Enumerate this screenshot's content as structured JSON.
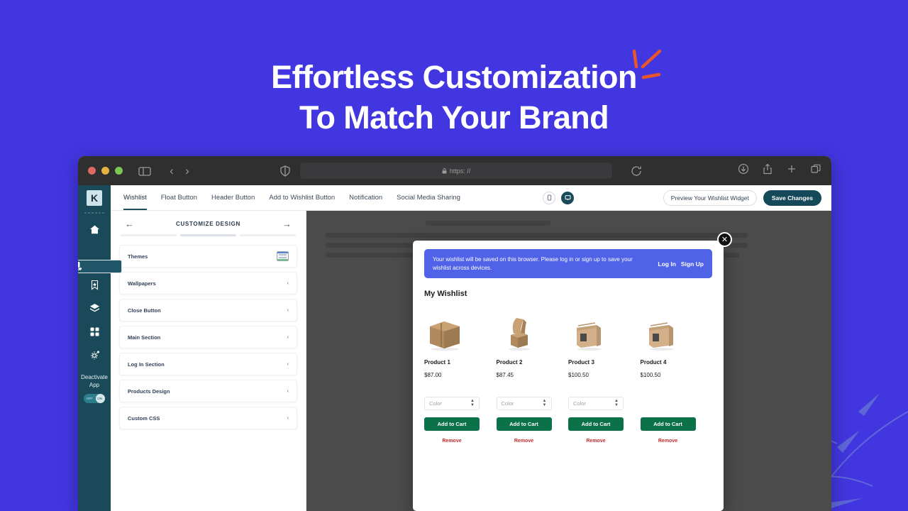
{
  "colors": {
    "background": "#4236e0",
    "accent_orange": "#e8562a",
    "brand_teal": "#1a4a59",
    "notice_blue": "#4f62e8",
    "cart_green": "#0a7148",
    "remove_red": "#c22a2a"
  },
  "hero": {
    "line1": "Effortless Customization",
    "line2": "To Match Your Brand",
    "burst_icon": "sparkle-burst-icon"
  },
  "browser": {
    "traffic_lights": [
      "close-red",
      "minimize-yellow",
      "maximize-green"
    ],
    "sidebar_icon": "sidebar-toggle-icon",
    "back_icon": "chevron-left-icon",
    "forward_icon": "chevron-right-icon",
    "shield_icon": "privacy-shield-icon",
    "url": "https: //",
    "lock_icon": "lock-icon",
    "reload_icon": "reload-icon",
    "right_icons": [
      "download-icon",
      "share-icon",
      "new-tab-icon",
      "tab-overview-icon"
    ]
  },
  "app": {
    "logo_letter": "K",
    "tabs": [
      {
        "label": "Wishlist",
        "active": true
      },
      {
        "label": "Float Button",
        "active": false
      },
      {
        "label": "Header Button",
        "active": false
      },
      {
        "label": "Add to Wishlist Button",
        "active": false
      },
      {
        "label": "Notification",
        "active": false
      },
      {
        "label": "Social Media Sharing",
        "active": false
      }
    ],
    "devices": [
      {
        "icon": "mobile-icon",
        "active": false
      },
      {
        "icon": "desktop-icon",
        "active": true
      }
    ],
    "preview_button": "Preview Your Wishlist Widget",
    "save_button": "Save Changes"
  },
  "rail": {
    "icons": [
      {
        "name": "home-icon",
        "selected": false
      },
      {
        "name": "list-heart-icon",
        "selected": true
      },
      {
        "name": "bookmark-icon",
        "selected": false
      },
      {
        "name": "layers-icon",
        "selected": false
      },
      {
        "name": "grid-icon",
        "selected": false
      },
      {
        "name": "gear-icon",
        "selected": false
      }
    ],
    "deactivate_line1": "Deactivate",
    "deactivate_line2": "App",
    "toggle_off": "OFF",
    "toggle_on": "ON",
    "toggle_state": "on"
  },
  "panel": {
    "title": "CUSTOMIZE DESIGN",
    "back_arrow": "←",
    "next_arrow": "→",
    "steps": [
      false,
      true,
      false
    ],
    "items": [
      {
        "label": "Themes",
        "has_thumb": true,
        "chevron": ""
      },
      {
        "label": "Wallpapers",
        "has_thumb": false,
        "chevron": "‹"
      },
      {
        "label": "Close Button",
        "has_thumb": false,
        "chevron": "‹"
      },
      {
        "label": "Main Section",
        "has_thumb": false,
        "chevron": "‹"
      },
      {
        "label": "Log In Section",
        "has_thumb": false,
        "chevron": "‹"
      },
      {
        "label": "Products Design",
        "has_thumb": false,
        "chevron": "‹"
      },
      {
        "label": "Custom CSS",
        "has_thumb": false,
        "chevron": "‹"
      }
    ]
  },
  "modal": {
    "close_icon": "close-icon",
    "notice_text": "Your wishlist will be saved on this browser. Please log in or sign up to save your wishlist across devices.",
    "login_label": "Log In",
    "signup_label": "Sign Up",
    "title": "My Wishlist",
    "products": [
      {
        "name": "Product 1",
        "price": "$87.00",
        "color_placeholder": "Color",
        "has_color": true,
        "cart_label": "Add to Cart",
        "remove_label": "Remove"
      },
      {
        "name": "Product 2",
        "price": "$87.45",
        "color_placeholder": "Color",
        "has_color": true,
        "cart_label": "Add to Cart",
        "remove_label": "Remove"
      },
      {
        "name": "Product 3",
        "price": "$100.50",
        "color_placeholder": "Color",
        "has_color": true,
        "cart_label": "Add to Cart",
        "remove_label": "Remove"
      },
      {
        "name": "Product 4",
        "price": "$100.50",
        "color_placeholder": "Color",
        "has_color": false,
        "cart_label": "Add to Cart",
        "remove_label": "Remove"
      }
    ]
  }
}
